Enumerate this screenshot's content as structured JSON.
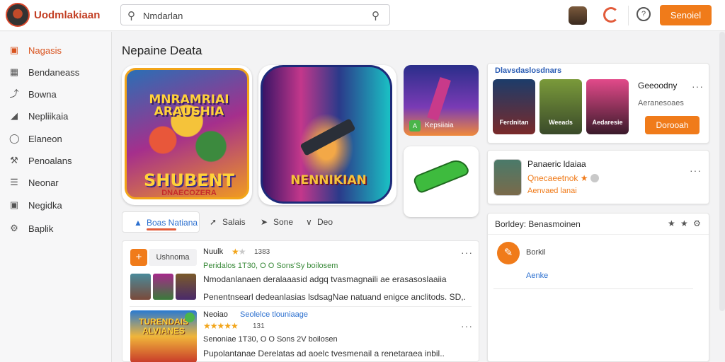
{
  "header": {
    "brand": "Uodmlakiaan",
    "search_value": "Nmdarlan",
    "primary_button": "Senoiel",
    "info_glyph": "?"
  },
  "sidebar": {
    "items": [
      {
        "label": "Nagasis",
        "icon": "store-icon",
        "active": true
      },
      {
        "label": "Bendaneass",
        "icon": "grid-icon",
        "active": false
      },
      {
        "label": "Bowna",
        "icon": "download-icon",
        "active": false
      },
      {
        "label": "Nepliikaia",
        "icon": "controller-icon",
        "active": false
      },
      {
        "label": "Elaneon",
        "icon": "tag-icon",
        "active": false
      },
      {
        "label": "Penoalans",
        "icon": "wrench-icon",
        "active": false
      },
      {
        "label": "Neonar",
        "icon": "list-icon",
        "active": false
      },
      {
        "label": "Negidka",
        "icon": "bag-icon",
        "active": false
      },
      {
        "label": "Baplik",
        "icon": "gear-icon",
        "active": false
      }
    ]
  },
  "main": {
    "title": "Nepaine Deata",
    "tiles": [
      {
        "top_text": "MNRAMRIAI\nARAUSHIA",
        "main_text": "SHUBENT",
        "sub_text": "DNAECOZERA"
      },
      {
        "main_text": "NENNIKIAN"
      },
      {
        "badge": "A",
        "label": "Kepsiiaia"
      },
      {}
    ]
  },
  "tabs": [
    {
      "label": "Boas Natiana",
      "icon": "person-icon",
      "active": true
    },
    {
      "label": "Salais",
      "icon": "arrow-icon",
      "active": false
    },
    {
      "label": "Sone",
      "icon": "paw-icon",
      "active": false
    },
    {
      "label": "Deo",
      "icon": "chevron-icon",
      "active": false
    }
  ],
  "feed": {
    "item1": {
      "pill": "Ushnoma",
      "author": "Nuulk",
      "rating": 1.5,
      "count": "1383",
      "meta": "Peridalos 1T30, O O Sons'Sy boilosem",
      "desc": "Nmodanlanaen deralaaasid adgq tvasmagnaili ae erasasoslaaiia",
      "desc2": "Penentnsearl dedeanlasias lsdsagNae natuand enigce anclitods.  SD,."
    },
    "item2": {
      "thumb_text": "TURENDAIS\nALVIANES",
      "author": "Neoiao",
      "author_link": "Seolelce tlouniaage",
      "rating": 5,
      "count": "131",
      "meta": "Senoniae 1T30, O O Sons 2V boilosen",
      "desc": "Pupolantanae Derelatas  ad aoelc tvesmenail a  renetaraea inbil.."
    }
  },
  "right": {
    "collection": {
      "title": "Dlavsdaslosdnars",
      "games": [
        "Ferdnitan",
        "Weeads",
        "Aedaresie"
      ],
      "label": "Geeoodny",
      "sub": "Aeranesoaes",
      "button": "Dorooah"
    },
    "profile": {
      "name": "Panaeric ldaiaa",
      "handle": "Qnecaeetnok",
      "stars": "★",
      "sub": "Aenvaed lanai"
    },
    "activity": {
      "header": "Borldey: Benasmoinen",
      "item_title": "Borkil",
      "item_link": "Aenke"
    }
  },
  "colors": {
    "accent": "#f07b1a",
    "brand": "#c23d22",
    "link": "#2b6fcf",
    "star": "#f2a51a"
  }
}
